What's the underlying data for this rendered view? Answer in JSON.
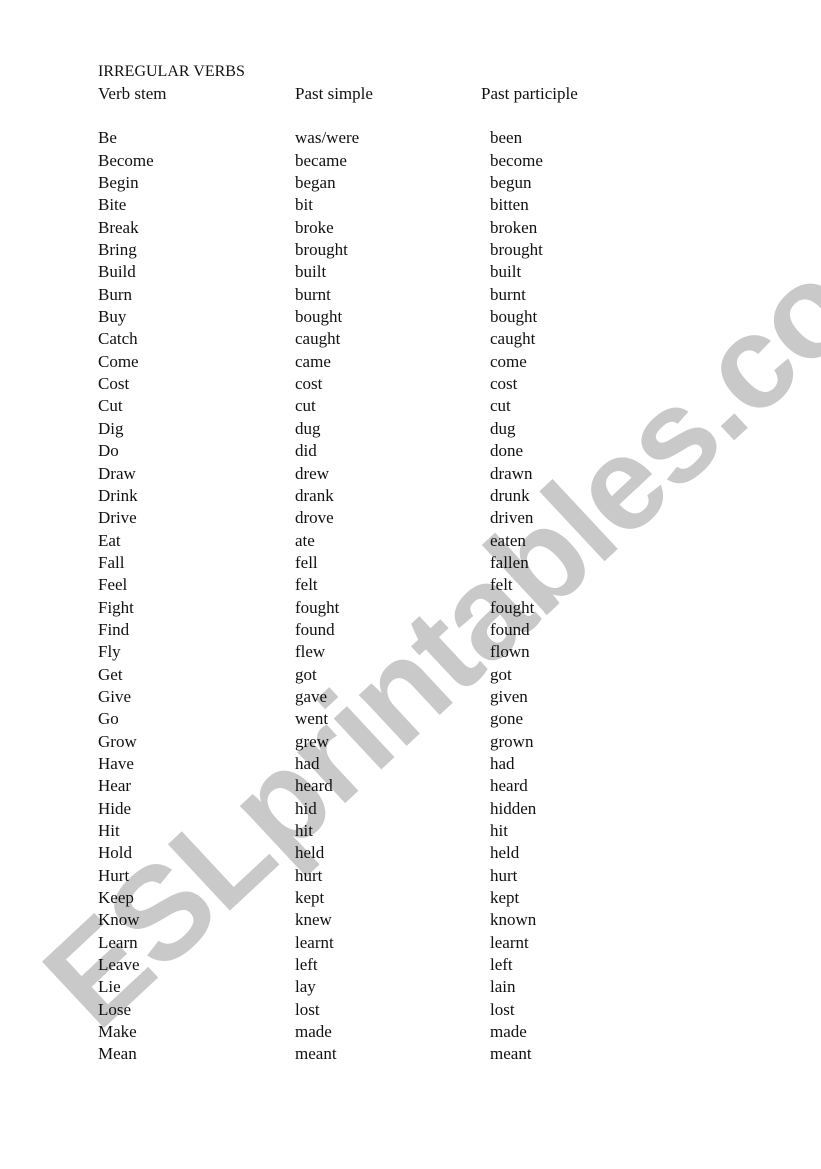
{
  "document": {
    "title": "IRREGULAR VERBS",
    "watermark": "ESLprintables.com",
    "columns": [
      "Verb stem",
      "Past simple",
      "Past participle"
    ],
    "rows": [
      [
        "Be",
        "was/were",
        "been"
      ],
      [
        "Become",
        "became",
        "become"
      ],
      [
        "Begin",
        "began",
        "begun"
      ],
      [
        "Bite",
        "bit",
        "bitten"
      ],
      [
        "Break",
        "broke",
        "broken"
      ],
      [
        "Bring",
        "brought",
        "brought"
      ],
      [
        "Build",
        "built",
        "built"
      ],
      [
        "Burn",
        "burnt",
        "burnt"
      ],
      [
        "Buy",
        "bought",
        "bought"
      ],
      [
        "Catch",
        "caught",
        "caught"
      ],
      [
        "Come",
        "came",
        "come"
      ],
      [
        "Cost",
        "cost",
        "cost"
      ],
      [
        "Cut",
        "cut",
        "cut"
      ],
      [
        "Dig",
        "dug",
        "dug"
      ],
      [
        "Do",
        "did",
        "done"
      ],
      [
        "Draw",
        "drew",
        "drawn"
      ],
      [
        "Drink",
        "drank",
        "drunk"
      ],
      [
        "Drive",
        "drove",
        "driven"
      ],
      [
        "Eat",
        "ate",
        "eaten"
      ],
      [
        "Fall",
        "fell",
        "fallen"
      ],
      [
        "Feel",
        "felt",
        "felt"
      ],
      [
        "Fight",
        "fought",
        "fought"
      ],
      [
        "Find",
        "found",
        "found"
      ],
      [
        "Fly",
        "flew",
        "flown"
      ],
      [
        "Get",
        "got",
        "got"
      ],
      [
        "Give",
        "gave",
        "given"
      ],
      [
        "Go",
        "went",
        "gone"
      ],
      [
        "Grow",
        "grew",
        "grown"
      ],
      [
        "Have",
        "had",
        "had"
      ],
      [
        "Hear",
        "heard",
        "heard"
      ],
      [
        "Hide",
        "hid",
        "hidden"
      ],
      [
        "Hit",
        "hit",
        "hit"
      ],
      [
        "Hold",
        "held",
        "held"
      ],
      [
        "Hurt",
        "hurt",
        "hurt"
      ],
      [
        "Keep",
        "kept",
        "kept"
      ],
      [
        "Know",
        "knew",
        "known"
      ],
      [
        "Learn",
        "learnt",
        "learnt"
      ],
      [
        "Leave",
        "left",
        "left"
      ],
      [
        "Lie",
        "lay",
        "lain"
      ],
      [
        "Lose",
        "lost",
        "lost"
      ],
      [
        "Make",
        "made",
        "made"
      ],
      [
        "Mean",
        "meant",
        "meant"
      ]
    ]
  }
}
